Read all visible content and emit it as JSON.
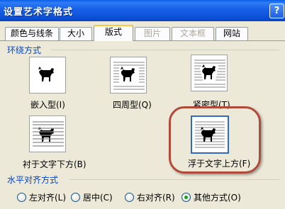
{
  "window": {
    "title": "设置艺术字格式",
    "help_label": "?"
  },
  "tabs": [
    {
      "label": "颜色与线条",
      "state": "normal"
    },
    {
      "label": "大小",
      "state": "normal"
    },
    {
      "label": "版式",
      "state": "active"
    },
    {
      "label": "图片",
      "state": "disabled"
    },
    {
      "label": "文本框",
      "state": "disabled"
    },
    {
      "label": "网站",
      "state": "normal"
    }
  ],
  "wrap_section": {
    "title": "环绕方式",
    "options": [
      {
        "label": "嵌入型(I)",
        "icon": "inline-dog-icon",
        "selected": false
      },
      {
        "label": "四周型(Q)",
        "icon": "square-wrap-dog-icon",
        "selected": false
      },
      {
        "label": "紧密型(T)",
        "icon": "tight-wrap-dog-icon",
        "selected": false
      },
      {
        "label": "衬于文字下方(B)",
        "icon": "behind-text-dog-icon",
        "selected": false
      },
      {
        "label": "浮于文字上方(F)",
        "icon": "in-front-text-dog-icon",
        "selected": true
      }
    ]
  },
  "align_section": {
    "title": "水平对齐方式",
    "options": [
      {
        "label": "左对齐(L)",
        "checked": false
      },
      {
        "label": "居中(C)",
        "checked": false
      },
      {
        "label": "右对齐(R)",
        "checked": false
      },
      {
        "label": "其他方式(O)",
        "checked": true
      }
    ]
  },
  "colors": {
    "title_bar": "#0b4fd6",
    "selection_border": "#316ac5",
    "annotation_ring": "#b24a3a",
    "section_label": "#0046d5"
  }
}
